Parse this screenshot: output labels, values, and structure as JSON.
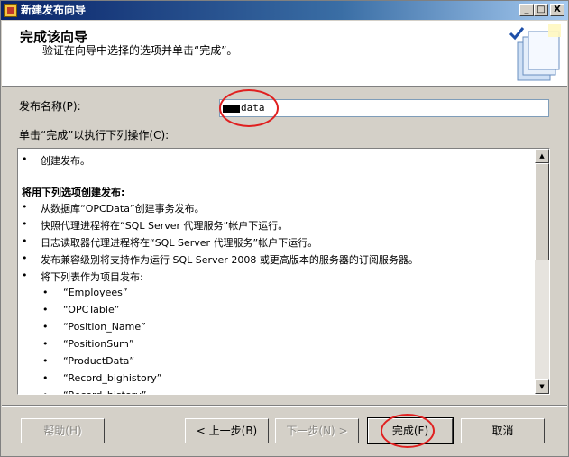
{
  "window": {
    "title": "新建发布向导",
    "controls": {
      "minimize": "_",
      "maximize": "□",
      "close": "X"
    }
  },
  "header": {
    "title": "完成该向导",
    "subtitle": "验证在向导中选择的选项并单击“完成”。",
    "icon": "wizard-book-icon"
  },
  "publication_name": {
    "label": "发布名称(P):",
    "value": "data"
  },
  "actions": {
    "label": "单击“完成”以执行下列操作(C):",
    "rows": [
      {
        "bullet": "•",
        "text": "创建发布。",
        "bold": false,
        "indent": 1
      },
      {
        "bullet": "",
        "text": "将用下列选项创建发布:",
        "bold": true,
        "indent": 0
      },
      {
        "bullet": "•",
        "text": "从数据库“OPCData”创建事务发布。",
        "bold": false,
        "indent": 1
      },
      {
        "bullet": "•",
        "text": "快照代理进程将在“SQL Server 代理服务”帐户下运行。",
        "bold": false,
        "indent": 1
      },
      {
        "bullet": "•",
        "text": "日志读取器代理进程将在“SQL Server 代理服务”帐户下运行。",
        "bold": false,
        "indent": 1
      },
      {
        "bullet": "•",
        "text": "发布兼容级别将支持作为运行 SQL Server 2008 或更高版本的服务器的订阅服务器。",
        "bold": false,
        "indent": 1
      },
      {
        "bullet": "•",
        "text": "将下列表作为项目发布:",
        "bold": false,
        "indent": 1
      },
      {
        "bullet": "•",
        "text": "“Employees”",
        "bold": false,
        "indent": 2
      },
      {
        "bullet": "•",
        "text": "“OPCTable”",
        "bold": false,
        "indent": 2
      },
      {
        "bullet": "•",
        "text": "“Position_Name”",
        "bold": false,
        "indent": 2
      },
      {
        "bullet": "•",
        "text": "“PositionSum”",
        "bold": false,
        "indent": 2
      },
      {
        "bullet": "•",
        "text": "“ProductData”",
        "bold": false,
        "indent": 2
      },
      {
        "bullet": "•",
        "text": "“Record_bighistory”",
        "bold": false,
        "indent": 2
      },
      {
        "bullet": "•",
        "text": "“Record_history”",
        "bold": false,
        "indent": 2
      }
    ]
  },
  "buttons": {
    "help": "帮助(H)",
    "back": "< 上一步(B)",
    "next": "下一步(N) >",
    "finish": "完成(F)",
    "cancel": "取消"
  },
  "colors": {
    "annotation_circle": "#e02020",
    "dialog_face": "#d4d0c8"
  }
}
